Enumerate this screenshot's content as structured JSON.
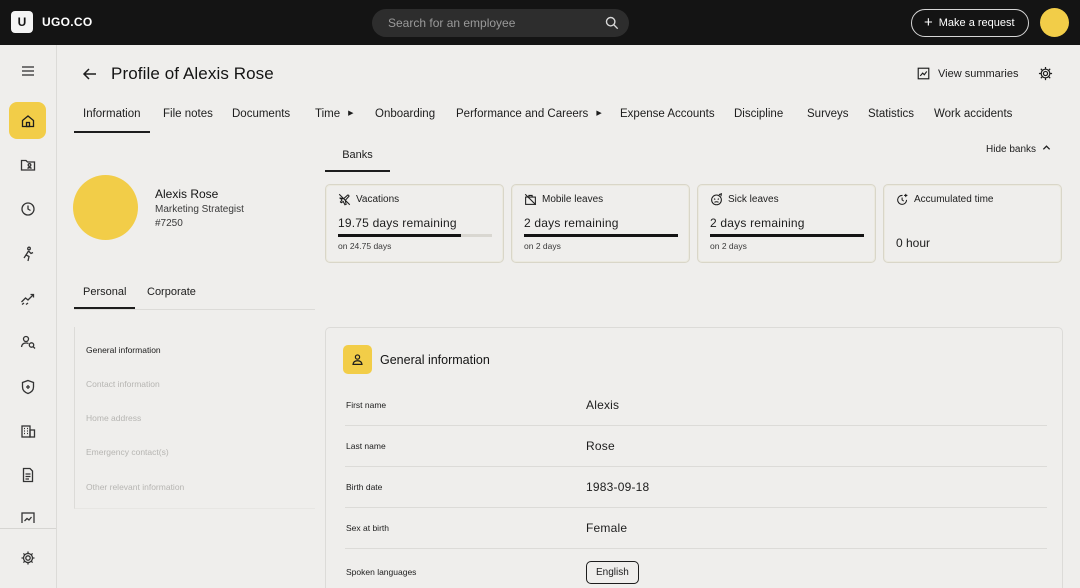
{
  "topbar": {
    "logo_letter": "U",
    "brand": "UGO.CO",
    "search_placeholder": "Search for an employee",
    "request_label": "Make a request"
  },
  "header": {
    "title": "Profile of Alexis Rose",
    "view_summaries": "View summaries"
  },
  "tabs": [
    {
      "label": "Information",
      "active": true
    },
    {
      "label": "File notes"
    },
    {
      "label": "Documents"
    },
    {
      "label": "Time",
      "has_caret": true
    },
    {
      "label": "Onboarding"
    },
    {
      "label": "Performance and Careers",
      "has_caret": true
    },
    {
      "label": "Expense Accounts"
    },
    {
      "label": "Discipline"
    },
    {
      "label": "Surveys"
    },
    {
      "label": "Statistics"
    },
    {
      "label": "Work accidents"
    }
  ],
  "profile": {
    "name": "Alexis Rose",
    "role": "Marketing Strategist",
    "employee_id": "#7250"
  },
  "banks": {
    "tab_label": "Banks",
    "hide_label": "Hide banks",
    "cards": [
      {
        "title": "Vacations",
        "remaining": "19.75 days remaining",
        "total": "on 24.75 days",
        "progress": 0.8
      },
      {
        "title": "Mobile leaves",
        "remaining": "2 days remaining",
        "total": "on 2 days",
        "progress": 1.0
      },
      {
        "title": "Sick leaves",
        "remaining": "2 days remaining",
        "total": "on 2 days",
        "progress": 1.0
      },
      {
        "title": "Accumulated time",
        "hours": "0 hour"
      }
    ]
  },
  "sub_tabs": {
    "personal": "Personal",
    "corporate": "Corporate"
  },
  "side_list": [
    "General information",
    "Contact information",
    "Home address",
    "Emergency contact(s)",
    "Other relevant information"
  ],
  "general_info": {
    "title": "General information",
    "fields": [
      {
        "label": "First name",
        "value": "Alexis"
      },
      {
        "label": "Last name",
        "value": "Rose"
      },
      {
        "label": "Birth date",
        "value": "1983-09-18"
      },
      {
        "label": "Sex at birth",
        "value": "Female"
      },
      {
        "label": "Spoken languages",
        "value": "English"
      }
    ]
  },
  "colors": {
    "accent": "#f2cd48",
    "topbar": "#141414",
    "background": "#efeeec"
  },
  "icons": {
    "sidebar": [
      "menu-icon",
      "home-icon",
      "folder-user-icon",
      "clock-icon",
      "person-running-icon",
      "chart-trend-icon",
      "user-search-icon",
      "shield-icon",
      "building-icon",
      "document-icon",
      "chart-box-icon",
      "gear-icon"
    ]
  }
}
